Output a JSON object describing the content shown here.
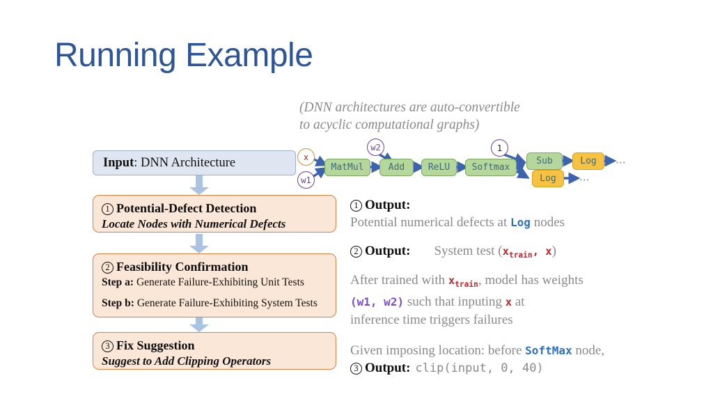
{
  "slide": {
    "title": "Running Example"
  },
  "caption": {
    "line1": "(DNN architectures are auto-convertible",
    "line2": "to acyclic computational graphs)"
  },
  "input_box": {
    "label_strong": "Input",
    "label_rest": ": DNN Architecture"
  },
  "stages": [
    {
      "number": "1",
      "title": "Potential-Defect Detection",
      "subtitle": "Locate Nodes with Numerical Defects"
    },
    {
      "number": "2",
      "title": "Feasibility Confirmation",
      "step_a_label": "Step a:",
      "step_a_text": " Generate Failure-Exhibiting Unit Tests",
      "step_b_label": "Step b:",
      "step_b_text": " Generate Failure-Exhibiting System Tests"
    },
    {
      "number": "3",
      "title": "Fix Suggestion",
      "subtitle": "Suggest to Add Clipping Operators"
    }
  ],
  "graph": {
    "inputs": [
      {
        "id": "x",
        "label": "x",
        "style": "orange"
      },
      {
        "id": "w1",
        "label": "w1",
        "style": "purple"
      },
      {
        "id": "w2",
        "label": "w2",
        "style": "purple"
      },
      {
        "id": "one",
        "label": "1",
        "style": "plain"
      }
    ],
    "nodes": [
      {
        "id": "matmul",
        "label": "MatMul",
        "style": "green"
      },
      {
        "id": "add",
        "label": "Add",
        "style": "green"
      },
      {
        "id": "relu",
        "label": "ReLU",
        "style": "green"
      },
      {
        "id": "softmax",
        "label": "Softmax",
        "style": "green"
      },
      {
        "id": "sub",
        "label": "Sub",
        "style": "green"
      },
      {
        "id": "log_top",
        "label": "Log",
        "style": "amber"
      },
      {
        "id": "log_bottom",
        "label": "Log",
        "style": "amber"
      }
    ],
    "ellipsis_top": "⋯",
    "ellipsis_bottom": "⋯",
    "colors": {
      "node_green_fill": "#b5d79b",
      "node_green_border": "#7aab5c",
      "node_amber_fill": "#f7c242",
      "node_amber_border": "#d9a21e",
      "node_text": "#3d6b78",
      "arrow": "#3c63ae",
      "circle_orange": "#d98b2b",
      "circle_purple": "#6b3fa0"
    }
  },
  "explanation": {
    "block1": {
      "number": "1",
      "head": "Output:",
      "text_before": "Potential numerical defects at ",
      "code": "Log",
      "text_after": " nodes"
    },
    "block2": {
      "number": "2",
      "head": "Output:",
      "text_before": "System test (",
      "code_x_train_base": "x",
      "code_x_train_sub": "train",
      "code_comma": ", ",
      "code_x": "x",
      "text_after": ")"
    },
    "block3": {
      "l1_before": "After trained with ",
      "l1_code_base": "x",
      "l1_code_sub": "train",
      "l1_after": ", model has weights",
      "l2_open": "(",
      "l2_w1": "w1,",
      "l2_w2": " w2",
      "l2_close": ")",
      "l2_mid": " such that inputing ",
      "l2_x": "x",
      "l2_end": " at",
      "l3": "inference time triggers failures"
    },
    "block4": {
      "l1_before": "Given imposing location: before ",
      "l1_code": "SoftMax",
      "l1_after": " node,",
      "number": "3",
      "head": "Output:",
      "code": "clip(input, 0, 40)"
    }
  },
  "colors": {
    "title": "#2e5597",
    "stage_fill": "#fbe7d7",
    "stage_border": "#d9803c",
    "input_fill": "#dfe6f2",
    "input_border": "#9aafc9",
    "flow_arrow": "#a9c3e0",
    "body_text": "#8a8a8a"
  }
}
